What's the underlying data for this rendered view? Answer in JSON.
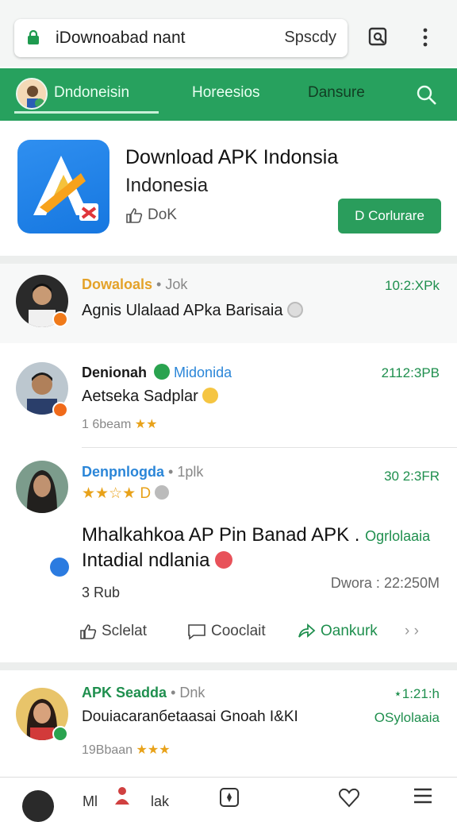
{
  "browser": {
    "url_text": "iDownoabad nant",
    "url_right": "Spscdy",
    "icons": [
      "lock-icon",
      "search-tab-icon",
      "more-vert-icon"
    ]
  },
  "tabs": {
    "items": [
      "Dndoneisin",
      "Horeesios",
      "Dansure"
    ],
    "icons": [
      "avatar-icon",
      "search-icon"
    ],
    "colors": {
      "bar": "#27a15e"
    }
  },
  "app": {
    "title": "Download APK Indonsia",
    "subtitle": "Indonesia",
    "likes": "DoK",
    "install_label": "D Corlurare"
  },
  "posts": [
    {
      "name": "Dowaloals",
      "meta": "• Jok",
      "time": "10:2:XPk",
      "body": "Agnis Ulalaad APka Barisaia"
    },
    {
      "name": "Denionah",
      "tag": "Midonida",
      "time": "2112:3PB",
      "body": "Aetseka Sadplar",
      "stars_text": "1 6beam"
    },
    {
      "name": "Denpnlogda",
      "meta": "• 1plk",
      "time": "30 2:3FR",
      "line1": "Mhalkahkoa AP Pin Banad APK .",
      "line1_tag": "Ogrlolaaia",
      "line2": "Intadial ndlania",
      "count": "3 Rub",
      "right_meta": "Dwora : 22:250M",
      "actions": {
        "select": "Sclelat",
        "comment": "Cooclait",
        "share": "Oankurk"
      }
    },
    {
      "name": "APK Seadda",
      "meta": "• Dnk",
      "time": "⋆1:21:h",
      "body": "Douiacaranбetaasai Gnoah I&KI",
      "body_tag": "OSylolaaia",
      "stars_text": "19Bbaan"
    }
  ],
  "bottom_nav": {
    "left_text": "Ml",
    "mid_text": "lak"
  }
}
